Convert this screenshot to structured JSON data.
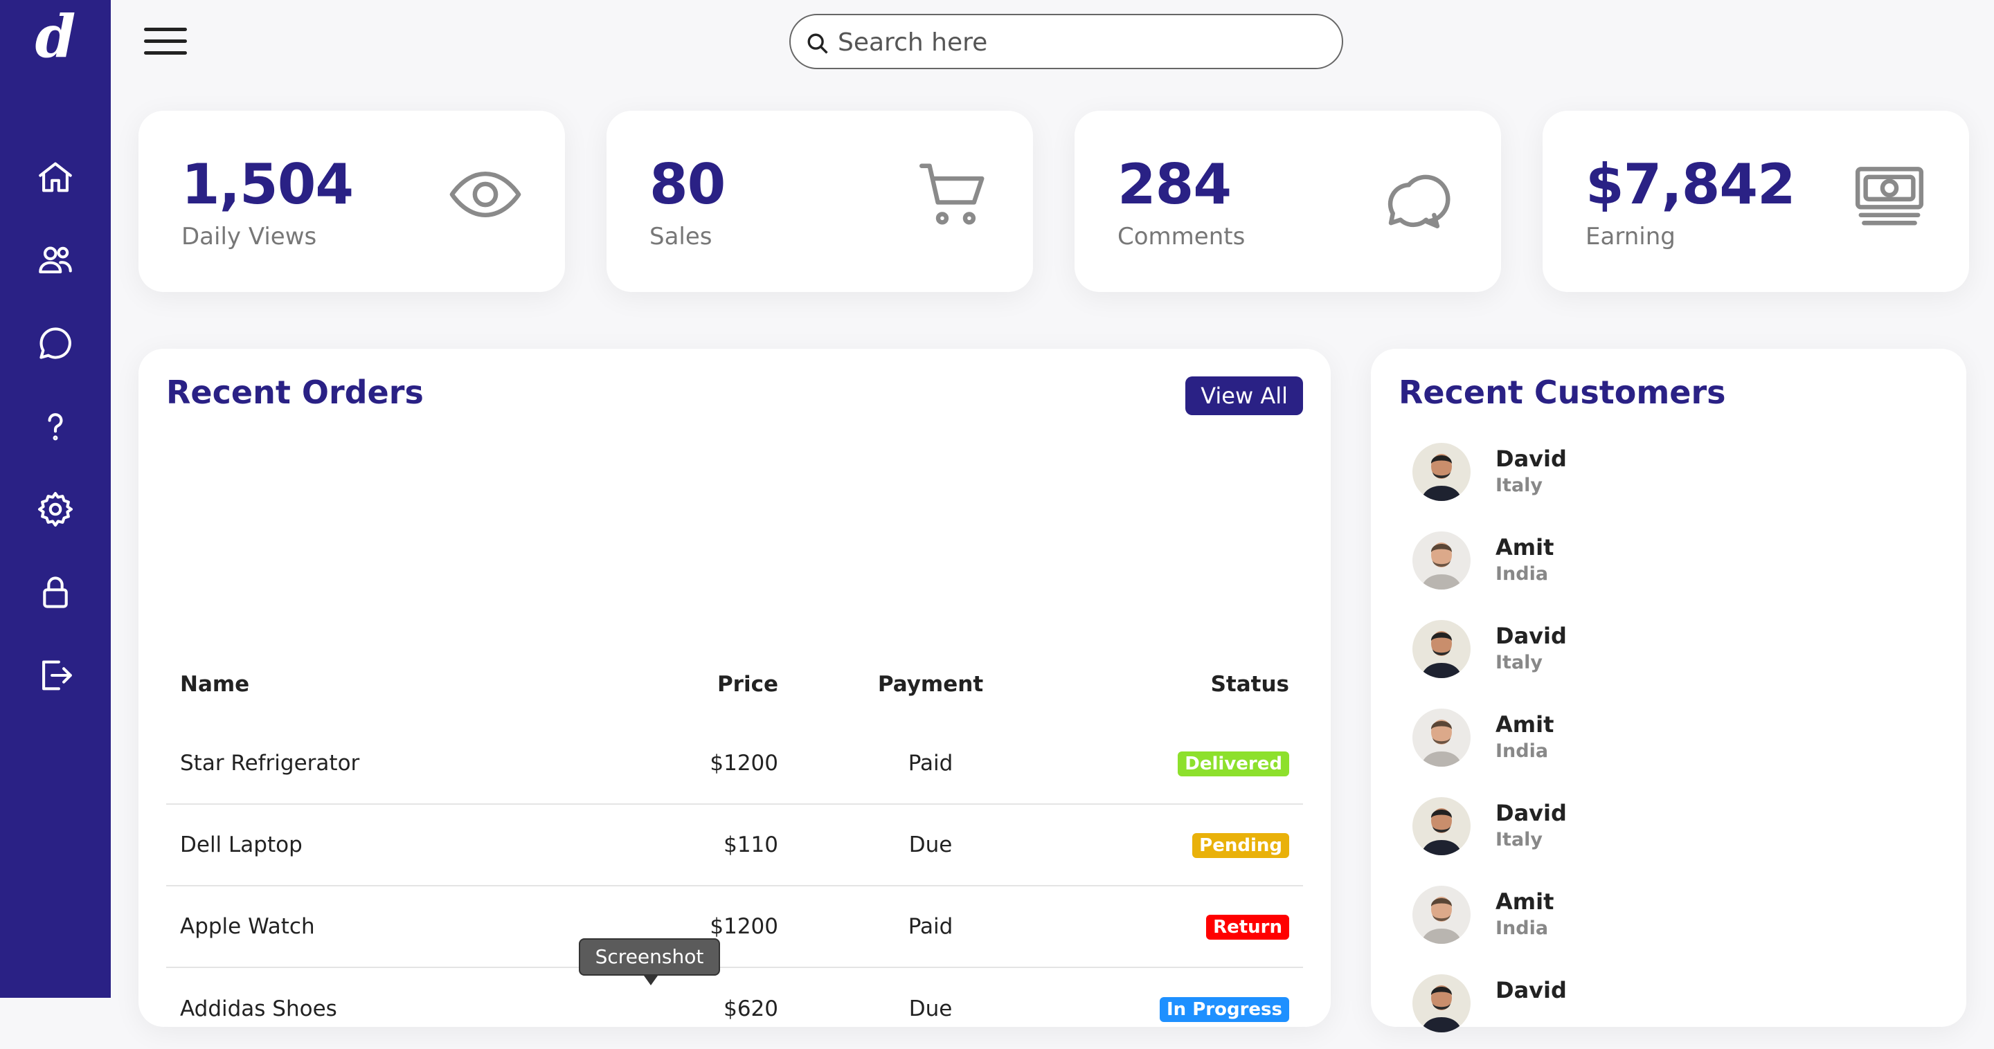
{
  "brand": {
    "logo": "d"
  },
  "search": {
    "placeholder": "Search here"
  },
  "stats": [
    {
      "value": "1,504",
      "label": "Daily Views",
      "icon": "eye-icon"
    },
    {
      "value": "80",
      "label": "Sales",
      "icon": "cart-icon"
    },
    {
      "value": "284",
      "label": "Comments",
      "icon": "chat-icon"
    },
    {
      "value": "$7,842",
      "label": "Earning",
      "icon": "cash-icon"
    }
  ],
  "orders": {
    "title": "Recent Orders",
    "view_all": "View All",
    "headers": {
      "name": "Name",
      "price": "Price",
      "payment": "Payment",
      "status": "Status"
    },
    "rows": [
      {
        "name": "Star Refrigerator",
        "price": "$1200",
        "payment": "Paid",
        "status": "Delivered",
        "status_color": "#8de02c"
      },
      {
        "name": "Dell Laptop",
        "price": "$110",
        "payment": "Due",
        "status": "Pending",
        "status_color": "#e9b10a"
      },
      {
        "name": "Apple Watch",
        "price": "$1200",
        "payment": "Paid",
        "status": "Return",
        "status_color": "#f00"
      },
      {
        "name": "Addidas Shoes",
        "price": "$620",
        "payment": "Due",
        "status": "In Progress",
        "status_color": "#1e90ff"
      }
    ]
  },
  "customers": {
    "title": "Recent Customers",
    "items": [
      {
        "name": "David",
        "country": "Italy"
      },
      {
        "name": "Amit",
        "country": "India"
      },
      {
        "name": "David",
        "country": "Italy"
      },
      {
        "name": "Amit",
        "country": "India"
      },
      {
        "name": "David",
        "country": "Italy"
      },
      {
        "name": "Amit",
        "country": "India"
      },
      {
        "name": "David",
        "country": ""
      }
    ]
  },
  "tooltip": {
    "text": "Screenshot"
  },
  "colors": {
    "primary": "#2a2185",
    "delivered": "#8de02c",
    "pending": "#e9b10a",
    "return": "#f00",
    "progress": "#1e90ff"
  }
}
